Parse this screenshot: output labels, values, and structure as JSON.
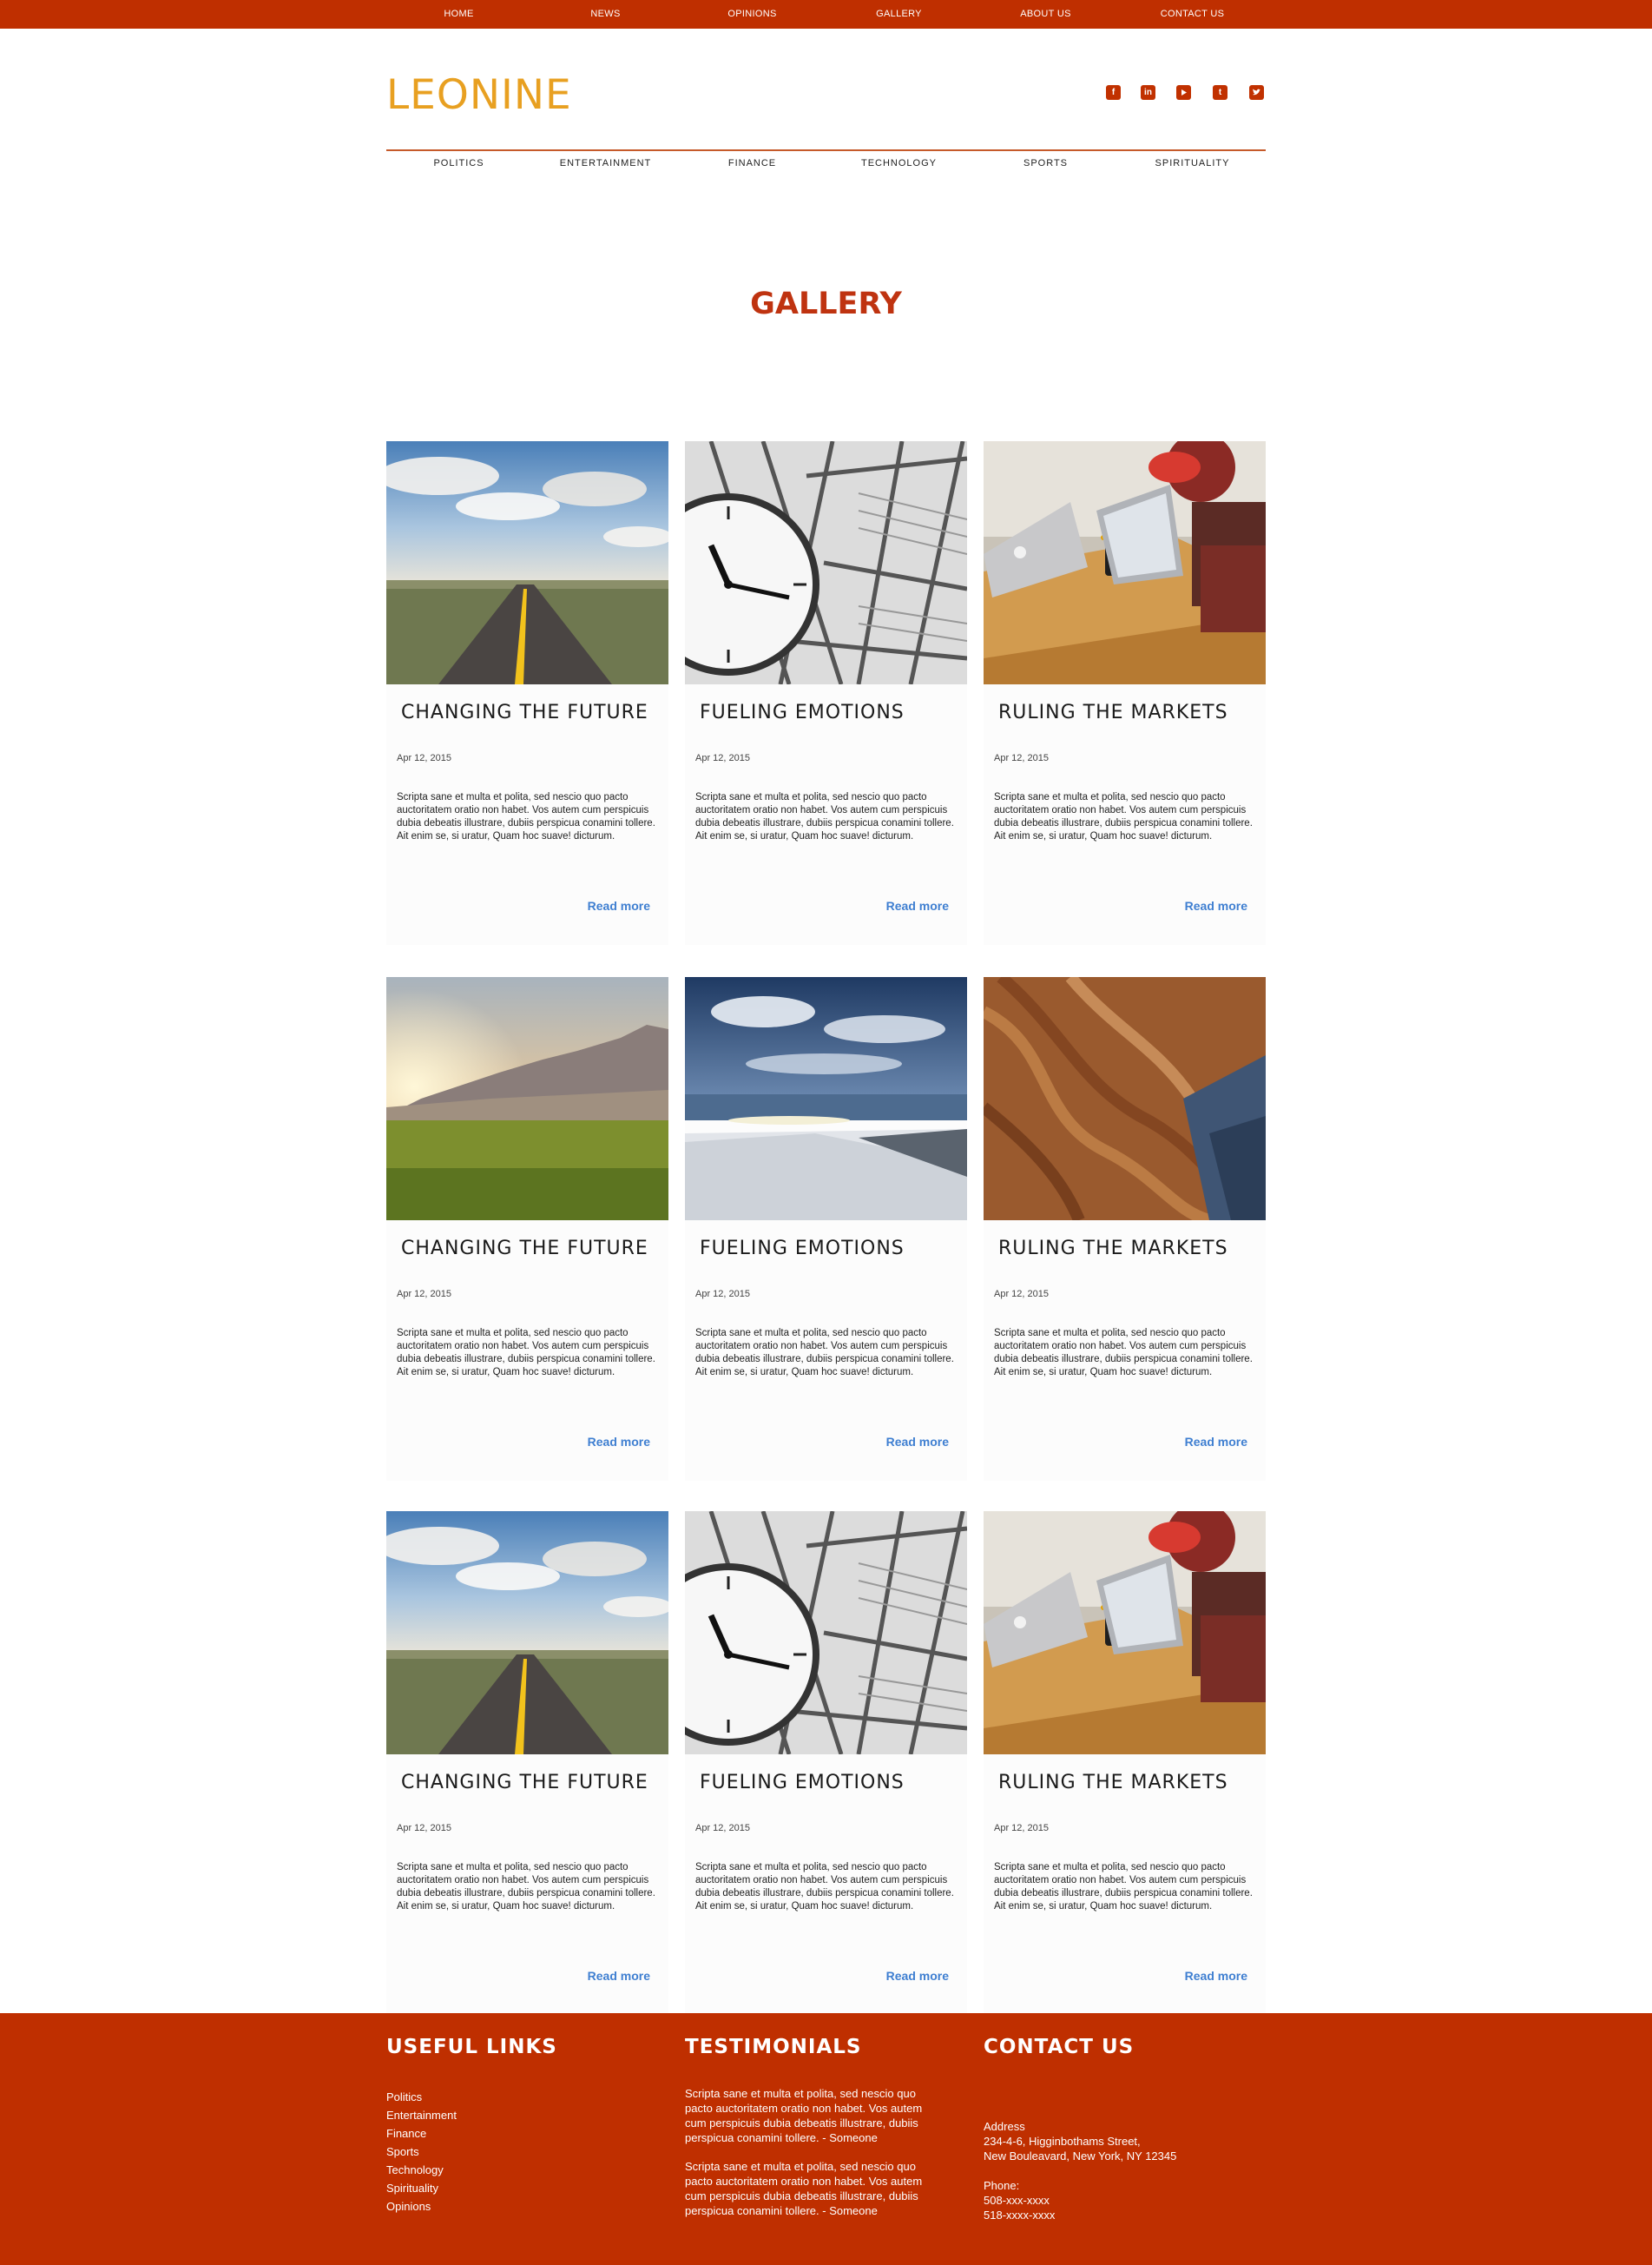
{
  "top_nav": [
    "HOME",
    "NEWS",
    "OPINIONS",
    "GALLERY",
    "ABOUT US",
    "CONTACT US"
  ],
  "brand": {
    "logo": "LEONINE",
    "logo_color": "#e8a021",
    "accent": "#bf2f00"
  },
  "social_icons": [
    "facebook-icon",
    "linkedin-icon",
    "youtube-icon",
    "tumblr-icon",
    "twitter-icon"
  ],
  "categories": [
    "POLITICS",
    "ENTERTAINMENT",
    "FINANCE",
    "TECHNOLOGY",
    "SPORTS",
    "SPIRITUALITY"
  ],
  "page_title": "GALLERY",
  "cards": [
    {
      "title": "CHANGING THE FUTURE",
      "date": "Apr 12, 2015",
      "body": "Scripta sane et multa et polita, sed nescio quo pacto auctoritatem oratio non habet. Vos autem cum perspicuis dubia debeatis illustrare, dubiis perspicua conamini tollere. Ait enim se, si uratur, Quam hoc suave! dicturum.",
      "more": "Read more",
      "image": "road"
    },
    {
      "title": "FUELING EMOTIONS",
      "date": "Apr 12, 2015",
      "body": "Scripta sane et multa et polita, sed nescio quo pacto auctoritatem oratio non habet. Vos autem cum perspicuis dubia debeatis illustrare, dubiis perspicua conamini tollere. Ait enim se, si uratur, Quam hoc suave! dicturum.",
      "more": "Read more",
      "image": "clock"
    },
    {
      "title": "RULING THE MARKETS",
      "date": "Apr 12, 2015",
      "body": "Scripta sane et multa et polita, sed nescio quo pacto auctoritatem oratio non habet. Vos autem cum perspicuis dubia debeatis illustrare, dubiis perspicua conamini tollere. Ait enim se, si uratur, Quam hoc suave! dicturum.",
      "more": "Read more",
      "image": "cafe"
    },
    {
      "title": "CHANGING THE FUTURE",
      "date": "Apr 12, 2015",
      "body": "Scripta sane et multa et polita, sed nescio quo pacto auctoritatem oratio non habet. Vos autem cum perspicuis dubia debeatis illustrare, dubiis perspicua conamini tollere. Ait enim se, si uratur, Quam hoc suave! dicturum.",
      "more": "Read more",
      "image": "meadow"
    },
    {
      "title": "FUELING EMOTIONS",
      "date": "Apr 12, 2015",
      "body": "Scripta sane et multa et polita, sed nescio quo pacto auctoritatem oratio non habet. Vos autem cum perspicuis dubia debeatis illustrare, dubiis perspicua conamini tollere. Ait enim se, si uratur, Quam hoc suave! dicturum.",
      "more": "Read more",
      "image": "snow"
    },
    {
      "title": "RULING THE MARKETS",
      "date": "Apr 12, 2015",
      "body": "Scripta sane et multa et polita, sed nescio quo pacto auctoritatem oratio non habet. Vos autem cum perspicuis dubia debeatis illustrare, dubiis perspicua conamini tollere. Ait enim se, si uratur, Quam hoc suave! dicturum.",
      "more": "Read more",
      "image": "hair"
    },
    {
      "title": "CHANGING THE FUTURE",
      "date": "Apr 12, 2015",
      "body": "Scripta sane et multa et polita, sed nescio quo pacto auctoritatem oratio non habet. Vos autem cum perspicuis dubia debeatis illustrare, dubiis perspicua conamini tollere. Ait enim se, si uratur, Quam hoc suave! dicturum.",
      "more": "Read more",
      "image": "road"
    },
    {
      "title": "FUELING EMOTIONS",
      "date": "Apr 12, 2015",
      "body": "Scripta sane et multa et polita, sed nescio quo pacto auctoritatem oratio non habet. Vos autem cum perspicuis dubia debeatis illustrare, dubiis perspicua conamini tollere. Ait enim se, si uratur, Quam hoc suave! dicturum.",
      "more": "Read more",
      "image": "clock"
    },
    {
      "title": "RULING THE MARKETS",
      "date": "Apr 12, 2015",
      "body": "Scripta sane et multa et polita, sed nescio quo pacto auctoritatem oratio non habet. Vos autem cum perspicuis dubia debeatis illustrare, dubiis perspicua conamini tollere. Ait enim se, si uratur, Quam hoc suave! dicturum.",
      "more": "Read more",
      "image": "cafe"
    }
  ],
  "footer": {
    "useful_links_title": "USEFUL LINKS",
    "useful_links": [
      "Politics",
      "Entertainment",
      "Finance",
      "Sports",
      "Technology",
      "Spirituality",
      "Opinions"
    ],
    "testimonials_title": "TESTIMONIALS",
    "testimonials": [
      "Scripta sane et multa et polita, sed nescio quo pacto auctoritatem oratio non habet. Vos autem cum perspicuis dubia debeatis illustrare, dubiis perspicua conamini tollere. - Someone",
      "Scripta sane et multa et polita, sed nescio quo pacto auctoritatem oratio non habet. Vos autem cum perspicuis dubia debeatis illustrare, dubiis perspicua conamini tollere. - Someone"
    ],
    "contact_title": "CONTACT US",
    "address_label": "Address",
    "address_line1": "234-4-6, Higginbothams Street,",
    "address_line2": "New Bouleavard, New York, NY 12345",
    "phone_label": "Phone:",
    "phone1": "508-xxx-xxxx",
    "phone2": "518-xxxx-xxxx"
  }
}
